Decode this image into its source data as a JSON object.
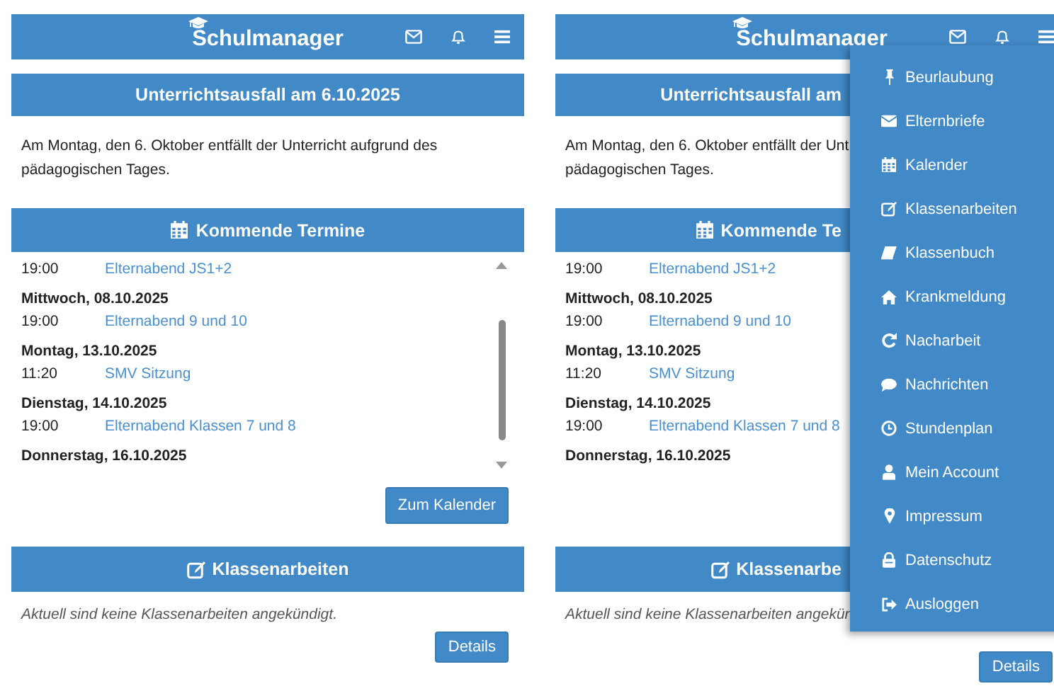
{
  "screens": [
    {
      "header": {
        "title": "Schulmanager"
      },
      "notice": {
        "title": "Unterrichtsausfall am 6.10.2025",
        "lines": [
          "Am Montag, den 6. Oktober entfällt der Unterricht aufgrund des",
          "pädagogischen Tages."
        ]
      },
      "events": {
        "title": "Kommende Termine",
        "items": [
          {
            "kind": "event",
            "time": "19:00",
            "title": "Elternabend JS1+2"
          },
          {
            "kind": "date",
            "label": "Mittwoch, 08.10.2025"
          },
          {
            "kind": "event",
            "time": "19:00",
            "title": "Elternabend 9 und 10"
          },
          {
            "kind": "date",
            "label": "Montag, 13.10.2025"
          },
          {
            "kind": "event",
            "time": "11:20",
            "title": "SMV Sitzung"
          },
          {
            "kind": "date",
            "label": "Dienstag, 14.10.2025"
          },
          {
            "kind": "event",
            "time": "19:00",
            "title": "Elternabend Klassen 7 und 8"
          },
          {
            "kind": "date",
            "label": "Donnerstag, 16.10.2025"
          }
        ],
        "button": "Zum Kalender"
      },
      "exams": {
        "title": "Klassenarbeiten",
        "text": "Aktuell sind keine Klassenarbeiten angekündigt.",
        "button": "Details"
      }
    },
    {
      "header": {
        "title": "Schulmanager"
      },
      "notice": {
        "title": "Unterrichtsausfall am",
        "lines": [
          "Am Montag, den 6. Oktober entfällt der Unt",
          "pädagogischen Tages."
        ]
      },
      "events": {
        "title": "Kommende Te",
        "items": [
          {
            "kind": "event",
            "time": "19:00",
            "title": "Elternabend JS1+2"
          },
          {
            "kind": "date",
            "label": "Mittwoch, 08.10.2025"
          },
          {
            "kind": "event",
            "time": "19:00",
            "title": "Elternabend 9 und 10"
          },
          {
            "kind": "date",
            "label": "Montag, 13.10.2025"
          },
          {
            "kind": "event",
            "time": "11:20",
            "title": "SMV Sitzung"
          },
          {
            "kind": "date",
            "label": "Dienstag, 14.10.2025"
          },
          {
            "kind": "event",
            "time": "19:00",
            "title": "Elternabend Klassen 7 und 8"
          },
          {
            "kind": "date",
            "label": "Donnerstag, 16.10.2025"
          }
        ]
      },
      "exams": {
        "title": "Klassenarbe",
        "text": "Aktuell sind keine Klassenarbeiten angekün",
        "button": "Details"
      },
      "menu": {
        "open": true,
        "items": [
          {
            "label": "Beurlaubung"
          },
          {
            "label": "Elternbriefe"
          },
          {
            "label": "Kalender"
          },
          {
            "label": "Klassenarbeiten"
          },
          {
            "label": "Klassenbuch"
          },
          {
            "label": "Krankmeldung"
          },
          {
            "label": "Nacharbeit"
          },
          {
            "label": "Nachrichten"
          },
          {
            "label": "Stundenplan"
          },
          {
            "label": "Mein Account"
          },
          {
            "label": "Impressum"
          },
          {
            "label": "Datenschutz"
          },
          {
            "label": "Ausloggen"
          }
        ]
      }
    }
  ]
}
